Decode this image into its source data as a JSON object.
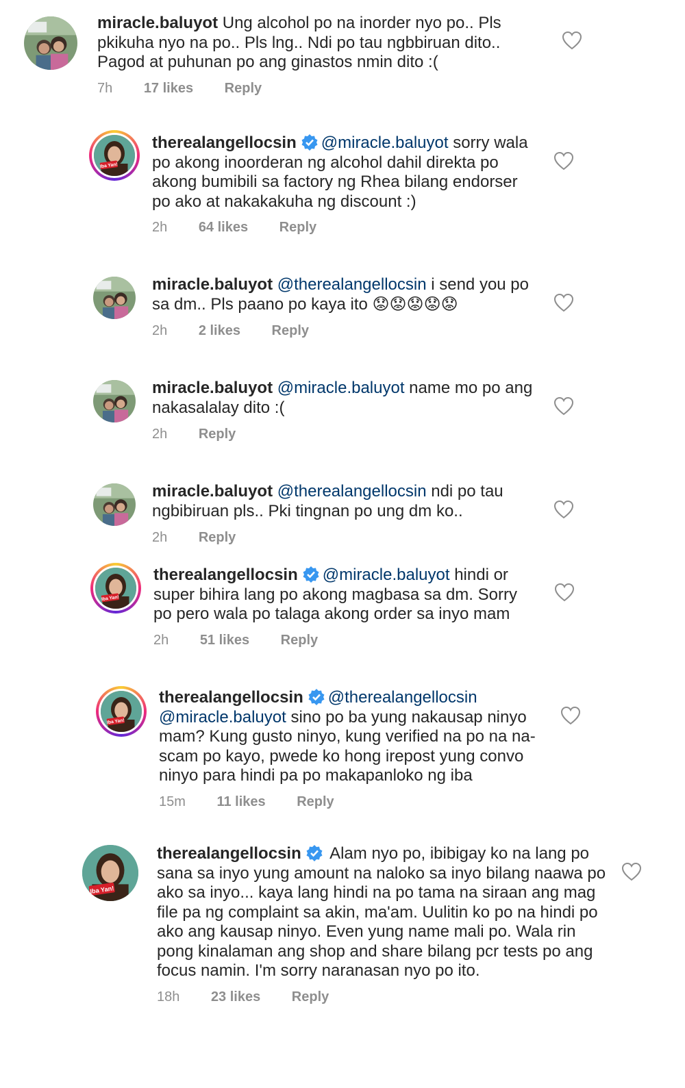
{
  "comments": [
    {
      "username": "miracle.baluyot",
      "verified": false,
      "mention": "",
      "body": "Ung alcohol po na inorder nyo po.. Pls pkikuha nyo na po.. Pls lng.. Ndi po tau ngbbiruan dito.. Pagod at puhunan po ang ginastos nmin dito :(",
      "time": "7h",
      "likes": "17 likes",
      "reply": "Reply"
    },
    {
      "username": "therealangellocsin",
      "verified": true,
      "mention": "@miracle.baluyot",
      "body": "sorry wala po akong inoorderan ng alcohol dahil direkta po akong bumibili sa factory ng Rhea bilang endorser po ako at nakakakuha ng discount :)",
      "time": "2h",
      "likes": "64 likes",
      "reply": "Reply"
    },
    {
      "username": "miracle.baluyot",
      "verified": false,
      "mention": "@therealangellocsin",
      "body": "i send you po sa dm.. Pls paano po kaya ito 😟😟😟😟😟",
      "time": "2h",
      "likes": "2 likes",
      "reply": "Reply"
    },
    {
      "username": "miracle.baluyot",
      "verified": false,
      "mention": "@miracle.baluyot",
      "body": "name mo po ang nakasalalay dito :(",
      "time": "2h",
      "likes": "",
      "reply": "Reply"
    },
    {
      "username": "miracle.baluyot",
      "verified": false,
      "mention": "@therealangellocsin",
      "body": "ndi po tau ngbibiruan pls.. Pki tingnan po ung dm ko..",
      "time": "2h",
      "likes": "",
      "reply": "Reply"
    },
    {
      "username": "therealangellocsin",
      "verified": true,
      "mention": "@miracle.baluyot",
      "body": "hindi or super bihira lang po akong magbasa sa dm. Sorry po pero wala po talaga akong order sa inyo mam",
      "time": "2h",
      "likes": "51 likes",
      "reply": "Reply"
    },
    {
      "username": "therealangellocsin",
      "verified": true,
      "mention": "@therealangellocsin @miracle.baluyot",
      "body": "sino po ba yung nakausap ninyo mam? Kung gusto ninyo, kung verified na po na na-scam po kayo, pwede ko hong irepost yung convo ninyo para hindi pa po makapanloko ng iba",
      "time": "15m",
      "likes": "11 likes",
      "reply": "Reply"
    },
    {
      "username": "therealangellocsin",
      "verified": true,
      "mention": "",
      "body": "Alam nyo po, ibibigay ko na lang po sana sa inyo yung amount na naloko sa inyo bilang naawa po ako sa inyo... kaya lang hindi na po tama na siraan ang mag file pa ng complaint sa akin, ma'am. Uulitin ko po na hindi po ako ang kausap ninyo. Even yung name mali po. Wala rin pong kinalaman ang shop and share bilang pcr tests po ang focus namin. I'm sorry naranasan nyo po ito.",
      "time": "18h",
      "likes": "23 likes",
      "reply": "Reply"
    }
  ],
  "icons": {
    "verified": "verified-badge-icon",
    "like": "heart-outline-icon",
    "avatar_miracle": "avatar-photo-two-people",
    "avatar_angel": "avatar-photo-woman-iba-yan"
  },
  "colors": {
    "mention": "#00376b",
    "meta": "#8e8e8e",
    "verified": "#3897f0",
    "iba_yan_red": "#d6202a"
  },
  "badge_text": "Iba Yan!"
}
